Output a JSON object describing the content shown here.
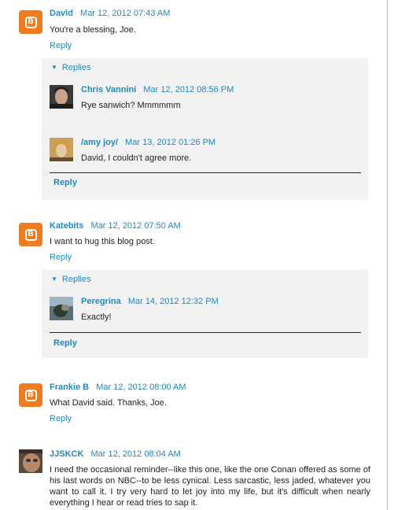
{
  "comments": [
    {
      "author": "David",
      "date": "Mar 12, 2012 07:43 AM",
      "text": "You're a blessing, Joe.",
      "reply_link": "Reply",
      "avatar_icon": "blogger-icon",
      "thread": {
        "toggle_label": "Replies",
        "replies": [
          {
            "author": "Chris Vannini",
            "date": "Mar 12, 2012 08:56 PM",
            "text": "Rye sanwich? Mmmmmm",
            "avatar_icon": "user-photo"
          },
          {
            "author": "/amy joy/",
            "date": "Mar 13, 2012 01:26 PM",
            "text": "David, I couldn't agree more.",
            "avatar_icon": "user-photo"
          }
        ],
        "reply_label": "Reply"
      }
    },
    {
      "author": "Katebits",
      "date": "Mar 12, 2012 07:50 AM",
      "text": "I want to hug this blog post.",
      "reply_link": "Reply",
      "avatar_icon": "blogger-icon",
      "thread": {
        "toggle_label": "Replies",
        "replies": [
          {
            "author": "Peregrina",
            "date": "Mar 14, 2012 12:32 PM",
            "text": "Exactly!",
            "avatar_icon": "user-photo"
          }
        ],
        "reply_label": "Reply"
      }
    },
    {
      "author": "Frankie B",
      "date": "Mar 12, 2012 08:00 AM",
      "text": "What David said. Thanks, Joe.",
      "reply_link": "Reply",
      "avatar_icon": "blogger-icon"
    },
    {
      "author": "JJSKCK",
      "date": "Mar 12, 2012 08:04 AM",
      "text": "I need the occasional reminder--like this one, like the one Conan offered as some of his last words on NBC--to be less cynical. Less sarcastic, less jaded, whatever you want to call it. I try very hard to let joy into my life, but it's difficult when nearly everything I hear or read tries to sap it.",
      "avatar_icon": "user-photo"
    }
  ],
  "colors": {
    "link": "#2288bb",
    "blogger_orange": "#f07c22",
    "thread_bg": "#f2f2f2"
  }
}
